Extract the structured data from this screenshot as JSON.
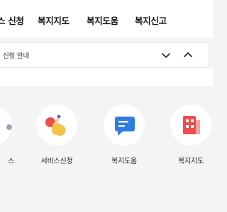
{
  "nav": {
    "items": [
      "스 신청",
      "복지지도",
      "복지도움",
      "복지신고"
    ]
  },
  "select": {
    "label": "신청 안내",
    "down_icon": "chevron-down-icon",
    "up_icon": "chevron-up-icon"
  },
  "services": [
    {
      "label": "스",
      "icon": "service-icon"
    },
    {
      "label": "서비스신청",
      "icon": "hand-tap-icon"
    },
    {
      "label": "복지도움",
      "icon": "chat-help-icon"
    },
    {
      "label": "복지지도",
      "icon": "map-icon"
    }
  ],
  "colors": {
    "background": "#f3f4f6",
    "chat_blue": "#2f7de0",
    "map_red": "#ef4c4c",
    "hand_yellow": "#f3c24a"
  }
}
